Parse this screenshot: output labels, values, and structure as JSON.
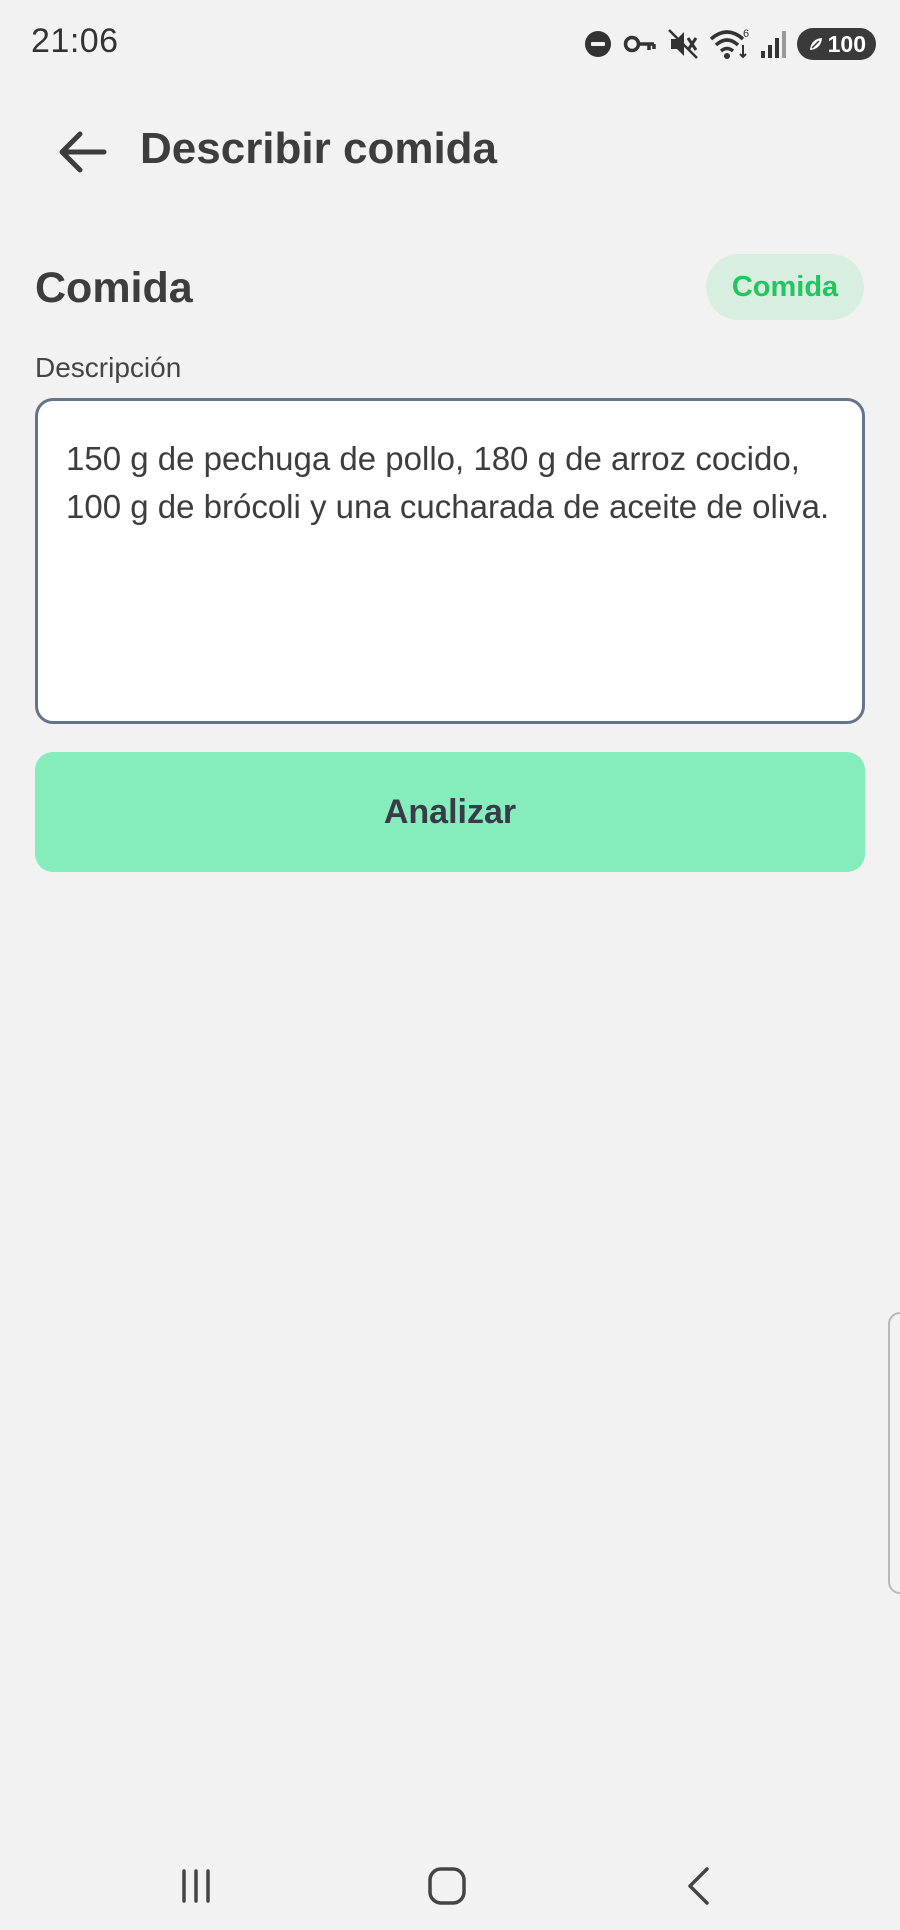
{
  "status_bar": {
    "time": "21:06",
    "battery": "100",
    "wifi_badge": "6",
    "icons": [
      "do-not-disturb-icon",
      "vpn-key-icon",
      "mute-icon",
      "wifi-icon",
      "signal-icon",
      "battery-icon"
    ]
  },
  "header": {
    "title": "Describir comida",
    "back_icon": "arrow-left-icon"
  },
  "section": {
    "title": "Comida",
    "type_chip": "Comida"
  },
  "description": {
    "label": "Descripción",
    "value": "150 g de pechuga de pollo, 180 g de arroz cocido, 100 g de brócoli y una cucharada de aceite de oliva."
  },
  "actions": {
    "analyze_label": "Analizar"
  },
  "nav_bar": {
    "icons": [
      "recents-icon",
      "home-icon",
      "back-nav-icon"
    ]
  },
  "colors": {
    "background": "#f2f2f2",
    "accent_green": "#22c55e",
    "chip_background": "#d7eee1",
    "button_background": "#84edbb",
    "input_border": "#64748b"
  }
}
